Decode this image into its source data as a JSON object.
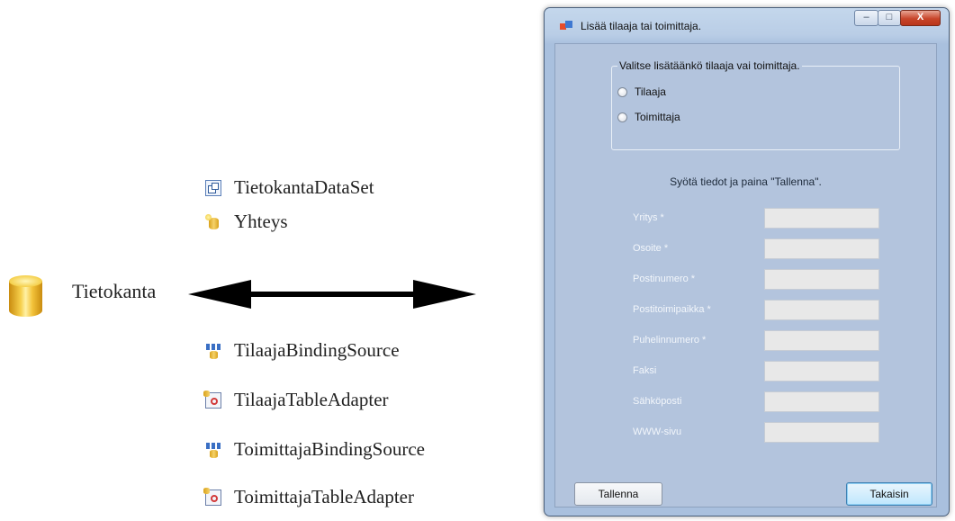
{
  "diagram": {
    "dataset_label": "TietokantaDataSet",
    "connection_label": "Yhteys",
    "database_label": "Tietokanta",
    "components": [
      "TilaajaBindingSource",
      "TilaajaTableAdapter",
      "ToimittajaBindingSource",
      "ToimittajaTableAdapter"
    ]
  },
  "dialog": {
    "title": "Lisää tilaaja tai toimittaja.",
    "window_controls": {
      "minimize": "–",
      "maximize": "□",
      "close": "X"
    },
    "group_title": "Valitse lisätäänkö tilaaja vai toimittaja.",
    "radio_options": [
      "Tilaaja",
      "Toimittaja"
    ],
    "instruction": "Syötä tiedot ja paina \"Tallenna\".",
    "fields": {
      "yritys": {
        "label": "Yritys *",
        "value": ""
      },
      "osoite": {
        "label": "Osoite *",
        "value": ""
      },
      "postinumero": {
        "label": "Postinumero *",
        "value": ""
      },
      "postitoimipaikka": {
        "label": "Postitoimipaikka *",
        "value": ""
      },
      "puhelinnumero": {
        "label": "Puhelinnumero *",
        "value": ""
      },
      "faksi": {
        "label": "Faksi",
        "value": ""
      },
      "sahkoposti": {
        "label": "Sähköposti",
        "value": ""
      },
      "www": {
        "label": "WWW-sivu",
        "value": ""
      }
    },
    "save_button": "Tallenna",
    "back_button": "Takaisin"
  },
  "colors": {
    "dialog_background": "#b3c4dd",
    "close_button": "#c8452a",
    "field_label": "#f2f6fb"
  },
  "icons": {
    "dataset": "dataset-icon",
    "connection": "connection-icon",
    "database": "database-icon",
    "binding_source": "binding-source-icon",
    "table_adapter": "table-adapter-icon",
    "app": "app-icon"
  }
}
